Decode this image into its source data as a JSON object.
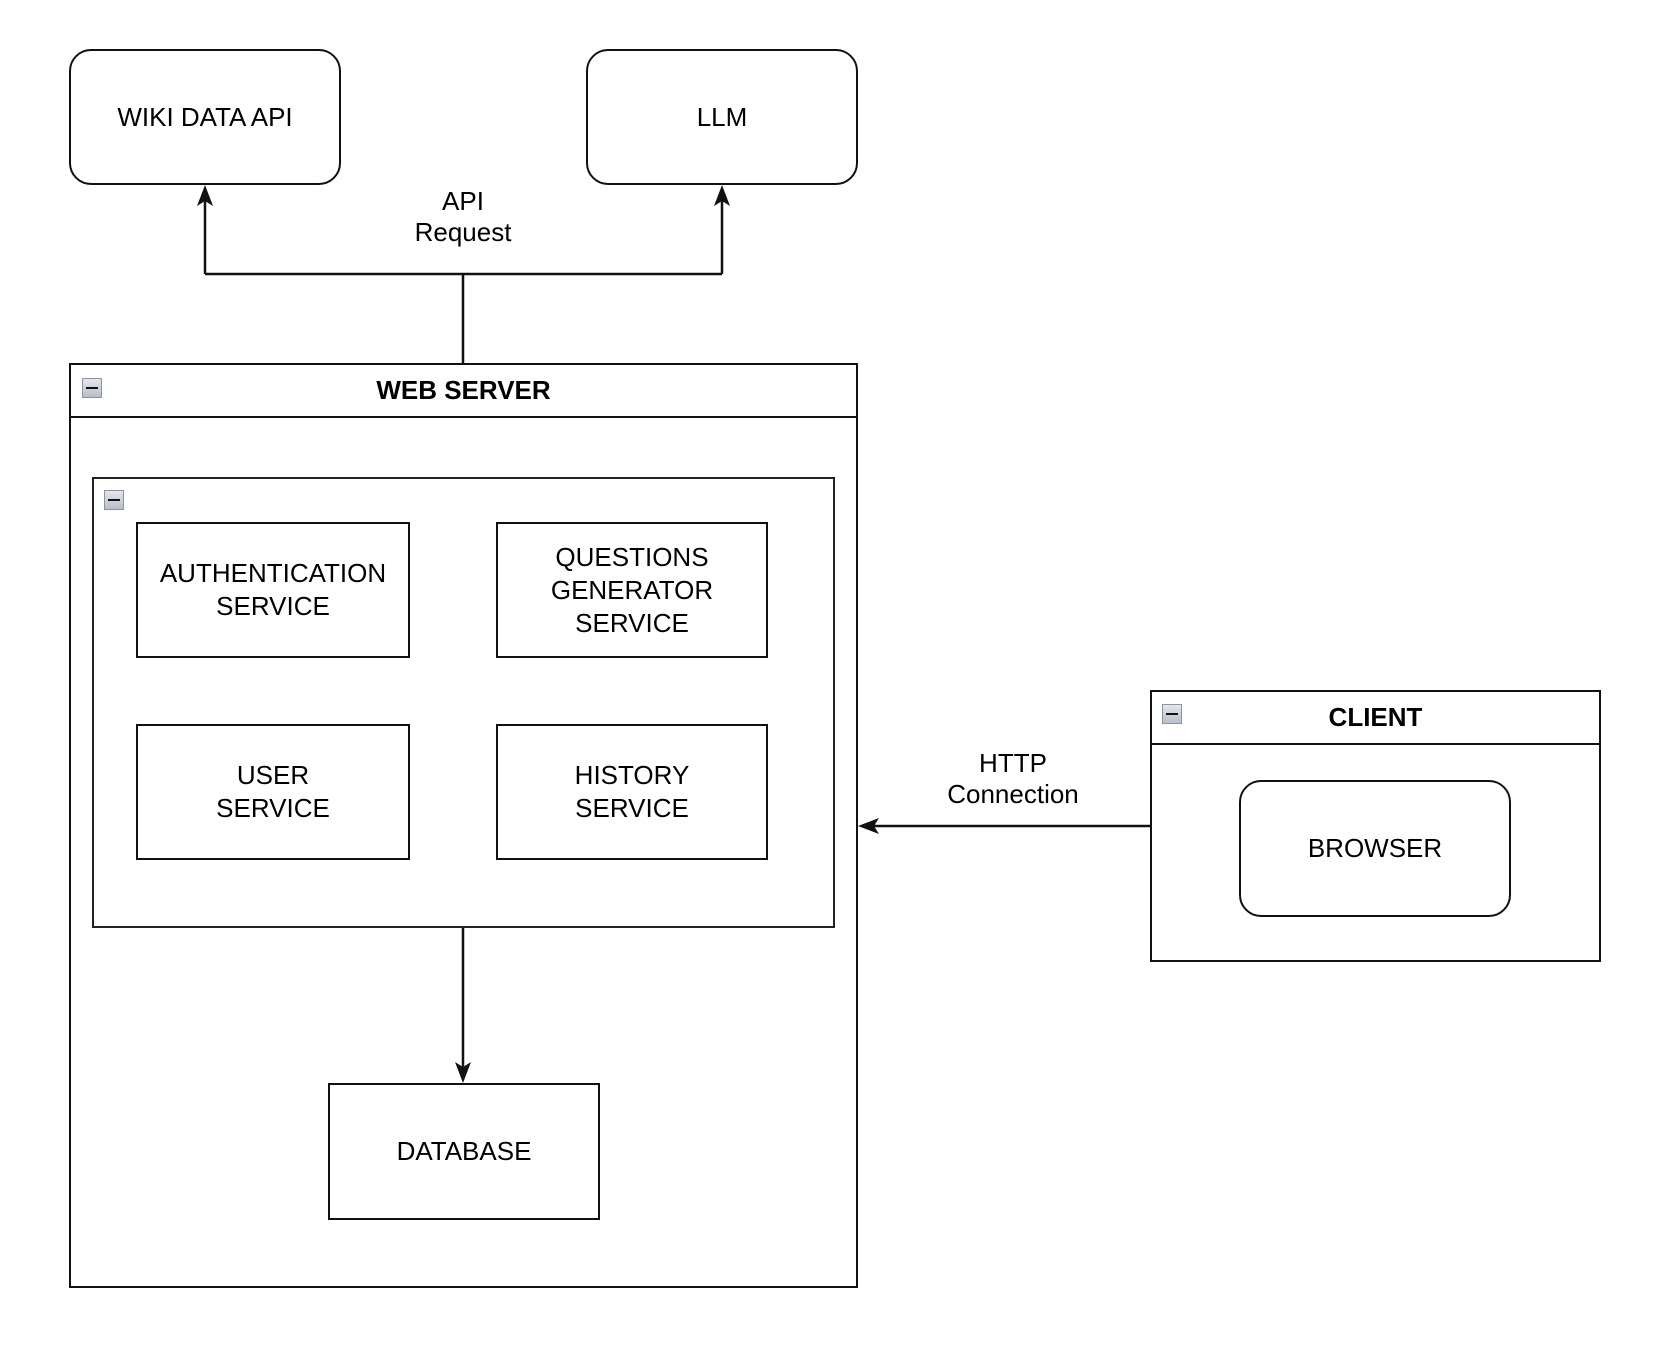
{
  "diagram": {
    "external": {
      "wiki_data_api": "WIKI DATA API",
      "llm": "LLM"
    },
    "edge_labels": {
      "api_request": "API\nRequest",
      "http_connection": "HTTP\nConnection"
    },
    "web_server": {
      "title": "WEB SERVER",
      "services": {
        "authentication": "AUTHENTICATION\nSERVICE",
        "questions_generator": "QUESTIONS\nGENERATOR\nSERVICE",
        "user": "USER\nSERVICE",
        "history": "HISTORY\nSERVICE"
      },
      "database": "DATABASE"
    },
    "client": {
      "title": "CLIENT",
      "browser": "BROWSER"
    },
    "edges": [
      {
        "from": "web_server",
        "to": "wiki_data_api",
        "label": "API Request"
      },
      {
        "from": "web_server",
        "to": "llm",
        "label": "API Request"
      },
      {
        "from": "services_container",
        "to": "database"
      },
      {
        "from": "client",
        "to": "web_server",
        "label": "HTTP Connection"
      }
    ]
  }
}
